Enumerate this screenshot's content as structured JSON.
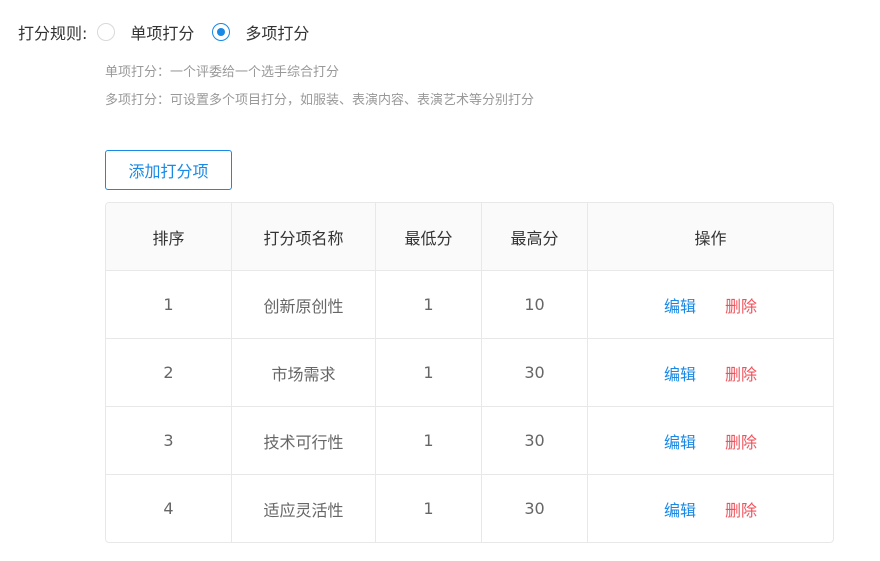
{
  "rule": {
    "label": "打分规则:",
    "options": [
      {
        "label": "单项打分",
        "checked": false
      },
      {
        "label": "多项打分",
        "checked": true
      }
    ],
    "hints": [
      "单项打分：一个评委给一个选手综合打分",
      "多项打分：可设置多个项目打分，如服装、表演内容、表演艺术等分别打分"
    ]
  },
  "add_button_label": "添加打分项",
  "table": {
    "headers": [
      "排序",
      "打分项名称",
      "最低分",
      "最高分",
      "操作"
    ],
    "edit_label": "编辑",
    "delete_label": "删除",
    "rows": [
      {
        "order": "1",
        "name": "创新原创性",
        "min": "1",
        "max": "10"
      },
      {
        "order": "2",
        "name": "市场需求",
        "min": "1",
        "max": "30"
      },
      {
        "order": "3",
        "name": "技术可行性",
        "min": "1",
        "max": "30"
      },
      {
        "order": "4",
        "name": "适应灵活性",
        "min": "1",
        "max": "30"
      }
    ]
  },
  "colors": {
    "accent": "#1989e6",
    "danger": "#f0525b"
  }
}
